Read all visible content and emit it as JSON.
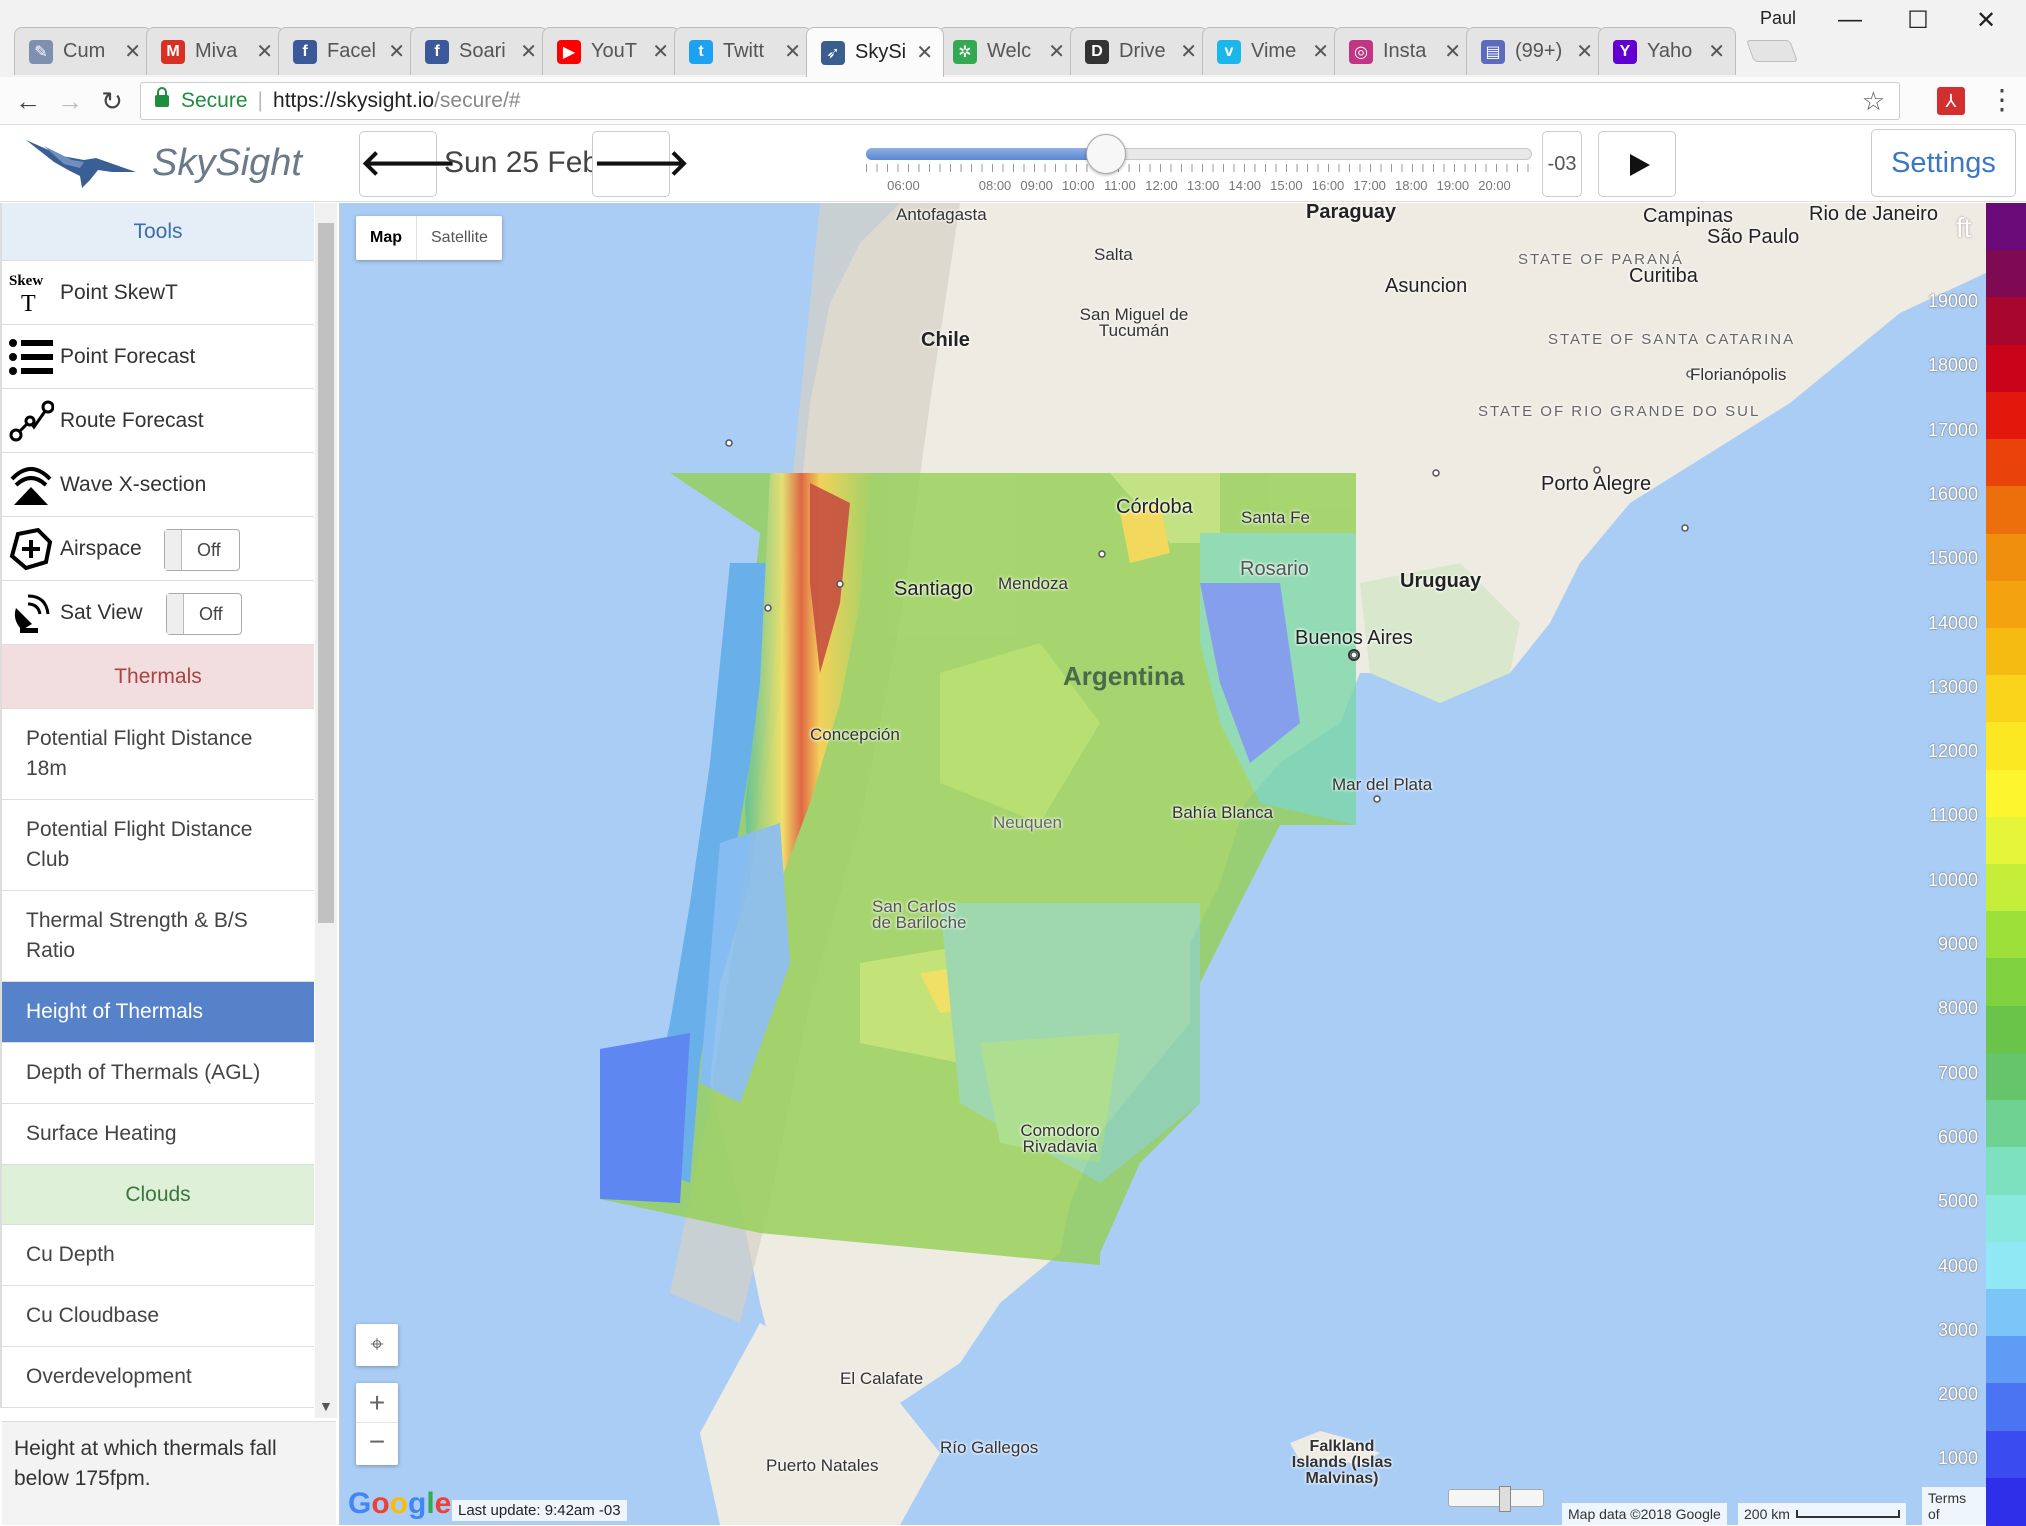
{
  "browser": {
    "profile": "Paul",
    "tabs": [
      {
        "label": "Cum",
        "icon": "feather-icon",
        "color": "#7e8fb0",
        "glyph": "✎"
      },
      {
        "label": "Miva",
        "icon": "gmail-icon",
        "color": "#d93025",
        "glyph": "M"
      },
      {
        "label": "Facel",
        "icon": "facebook-icon",
        "color": "#3b5998",
        "glyph": "f"
      },
      {
        "label": "Soari",
        "icon": "facebook-icon",
        "color": "#3b5998",
        "glyph": "f"
      },
      {
        "label": "YouT",
        "icon": "youtube-icon",
        "color": "#ff0000",
        "glyph": "▶"
      },
      {
        "label": "Twitt",
        "icon": "twitter-icon",
        "color": "#1da1f2",
        "glyph": "t"
      },
      {
        "label": "SkySi",
        "icon": "skysight-icon",
        "color": "#3a5f8f",
        "glyph": "➶",
        "active": true
      },
      {
        "label": "Welc",
        "icon": "pinwheel-icon",
        "color": "#34a853",
        "glyph": "✲"
      },
      {
        "label": "Drive",
        "icon": "drive-icon",
        "color": "#333333",
        "glyph": "D"
      },
      {
        "label": "Vime",
        "icon": "vimeo-icon",
        "color": "#1ab7ea",
        "glyph": "v"
      },
      {
        "label": "Insta",
        "icon": "instagram-icon",
        "color": "#c13584",
        "glyph": "◎"
      },
      {
        "label": "(99+)",
        "icon": "chat-icon",
        "color": "#5c6bc0",
        "glyph": "▤"
      },
      {
        "label": "Yaho",
        "icon": "yahoo-icon",
        "color": "#6001d2",
        "glyph": "Y"
      }
    ],
    "secure_label": "Secure",
    "url_host": "https://skysight.io",
    "url_path": "/secure/#"
  },
  "app": {
    "brand": "SkySight",
    "date": "Sun 25 Feb",
    "time_labels": [
      "06:00",
      "08:00",
      "09:00",
      "10:00",
      "11:00",
      "12:00",
      "13:00",
      "14:00",
      "15:00",
      "16:00",
      "17:00",
      "18:00",
      "19:00",
      "20:00"
    ],
    "time_progress": 0.36,
    "timezone": "-03",
    "settings_label": "Settings"
  },
  "sidebar": {
    "tools_header": "Tools",
    "tools": [
      {
        "label": "Point SkewT",
        "icon": "skewt-icon",
        "icon_text": "Skew T"
      },
      {
        "label": "Point Forecast",
        "icon": "list-icon"
      },
      {
        "label": "Route Forecast",
        "icon": "route-icon"
      },
      {
        "label": "Wave X-section",
        "icon": "wave-icon"
      },
      {
        "label": "Airspace",
        "icon": "airspace-icon",
        "toggle": "Off"
      },
      {
        "label": "Sat View",
        "icon": "satellite-icon",
        "toggle": "Off"
      }
    ],
    "thermals_header": "Thermals",
    "thermals": [
      {
        "label": "Potential Flight Distance 18m",
        "lines": 2
      },
      {
        "label": "Potential Flight Distance Club",
        "lines": 2
      },
      {
        "label": "Thermal Strength & B/S Ratio",
        "lines": 2
      },
      {
        "label": "Height of Thermals",
        "lines": 1,
        "selected": true
      },
      {
        "label": "Depth of Thermals (AGL)",
        "lines": 1
      },
      {
        "label": "Surface Heating",
        "lines": 1
      }
    ],
    "clouds_header": "Clouds",
    "clouds": [
      {
        "label": "Cu Depth"
      },
      {
        "label": "Cu Cloudbase"
      },
      {
        "label": "Overdevelopment"
      }
    ],
    "description": "Height at which thermals fall below 175fpm."
  },
  "map": {
    "map_button": "Map",
    "satellite_button": "Satellite",
    "last_update": "Last update: 9:42am -03",
    "map_data": "Map data ©2018 Google",
    "scale_label": "200 km",
    "terms": "Terms of",
    "google": "Google",
    "labels": {
      "antofagasta": "Antofagasta",
      "paraguay": "Paraguay",
      "campinas": "Campinas",
      "rio": "Rio de Janeiro",
      "saopaulo": "São Paulo",
      "salta": "Salta",
      "asuncion": "Asuncion",
      "curitiba": "Curitiba",
      "parana": "STATE OF PARANÁ",
      "tucuman": "San Miguel de Tucumán",
      "chile": "Chile",
      "santacatarina": "STATE OF SANTA CATARINA",
      "florianopolis": "Florianópolis",
      "riogrande": "STATE OF RIO GRANDE DO SUL",
      "portoalegre": "Porto Alegre",
      "cordoba": "Córdoba",
      "santafe": "Santa Fe",
      "rosario": "Rosario",
      "uruguay": "Uruguay",
      "santiago": "Santiago",
      "mendoza": "Mendoza",
      "buenosaires": "Buenos Aires",
      "argentina": "Argentina",
      "concepcion": "Concepción",
      "mardelplata": "Mar del Plata",
      "bahiablanca": "Bahía Blanca",
      "neuquen": "Neuquen",
      "bariloche": "San Carlos de Bariloche",
      "comodoro": "Comodoro Rivadavia",
      "calafate": "El Calafate",
      "riogallegos": "Río Gallegos",
      "puertonatales": "Puerto Natales",
      "falkland": "Falkland Islands (Islas Malvinas)"
    }
  },
  "legend": {
    "unit": "ft",
    "ticks": [
      19000,
      18000,
      17000,
      16000,
      15000,
      14000,
      13000,
      12000,
      11000,
      10000,
      9000,
      8000,
      7000,
      6000,
      5000,
      4000,
      3000,
      2000,
      1000
    ],
    "colors": [
      "#6a0a78",
      "#7d0a52",
      "#a8072d",
      "#c8031a",
      "#e2180c",
      "#e9430b",
      "#ec6f0b",
      "#f08e0d",
      "#f4a30f",
      "#f6bb13",
      "#f9d41a",
      "#fbe823",
      "#fdf62e",
      "#e5f53a",
      "#c4ee3a",
      "#9ee03a",
      "#7fd13f",
      "#6bc44a",
      "#66c46a",
      "#6fd293",
      "#7de0bf",
      "#8ae9df",
      "#8fe8f4",
      "#7cc6f7",
      "#5f9cf5",
      "#4a74f2",
      "#3a4cef",
      "#2f2fea"
    ]
  }
}
